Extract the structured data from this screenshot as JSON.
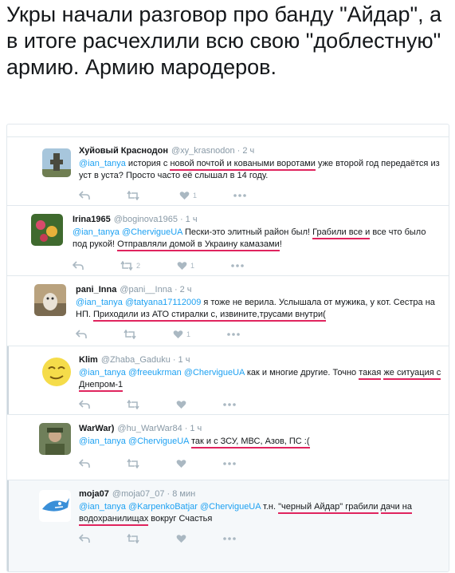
{
  "headline": "Укры начали разговор про банду \"Айдар\", а в итоге расчехлили всю свою \"доблестную\" армию. Армию мародеров.",
  "colors": {
    "accent": "#1da1f2",
    "underline": "#e0245e",
    "muted": "#8899a6"
  },
  "tweets": [
    {
      "name": "Хуйовый Краснодон",
      "handle": "@xy_krasnodon",
      "time": "2 ч",
      "m1": "@ian_tanya",
      "p1": " история с ",
      "u1": "новой почтой и коваными воротами",
      "p2": " уже второй год передаётся из уст в уста? Просто часто её слышал в 14 году.",
      "like_count": "1",
      "retweet_count": ""
    },
    {
      "name": "Irina1965",
      "handle": "@boginova1965",
      "time": "1 ч",
      "m1": "@ian_tanya",
      "m2": "@ChervigueUA",
      "p1": " Пески-это элитный район был! ",
      "u1": "Грабили все и",
      "p2": " все что было под рукой! ",
      "u2": "Отправляли домой в Украину камазами",
      "p3": "!",
      "retweet_count": "2",
      "like_count": "1"
    },
    {
      "name": "pani_Inna",
      "handle": "@pani__Inna",
      "time": "2 ч",
      "m1": "@ian_tanya",
      "m2": "@tatyana17112009",
      "p1": " я тоже не верила. Услышала от мужика, у кот. Сестра на НП. ",
      "u1": "Приходили из АТО стиралки с, извините,трусами внутри(",
      "like_count": "1"
    },
    {
      "name": "Klim",
      "handle": "@Zhaba_Gaduku",
      "time": "1 ч",
      "m1": "@ian_tanya",
      "m2": "@freeukrman",
      "m3": "@ChervigueUA",
      "p1": " как и многие другие. Точно ",
      "u1": "такая",
      "u2": "же ситуация с Днепром-1"
    },
    {
      "name": "WarWar)",
      "handle": "@hu_WarWar84",
      "time": "1 ч",
      "m1": "@ian_tanya",
      "m2": "@ChervigueUA",
      "u1": "так и с ЗСУ, МВС, Азов, ПС :("
    },
    {
      "name": "moja07",
      "handle": "@moja07_07",
      "time": "8 мин",
      "m1": "@ian_tanya",
      "m2": "@KarpenkoBatjar",
      "m3": "@ChervigueUA",
      "p1": " т.н. ",
      "u1": "\"черный Айдар\" грабили",
      "u2": "дачи на водохранилищах",
      "p2": " вокруг Счастья"
    }
  ]
}
